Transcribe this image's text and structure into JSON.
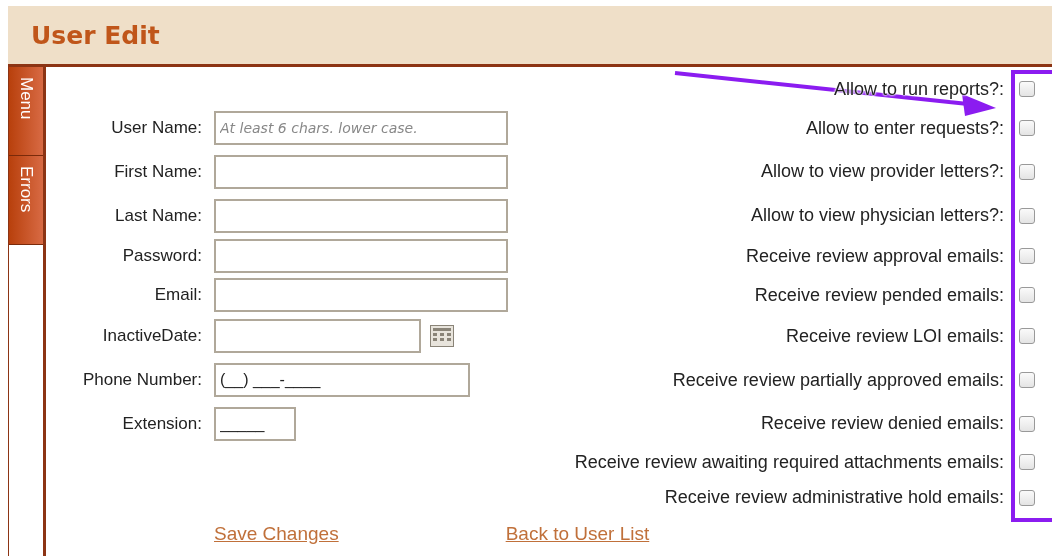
{
  "header": {
    "title": "User Edit"
  },
  "side_tabs": [
    {
      "label": "Menu"
    },
    {
      "label": "Errors"
    }
  ],
  "fields": [
    {
      "label": "User Name:",
      "kind": "text",
      "placeholder": "At least 6 chars. lower case."
    },
    {
      "label": "First Name:",
      "kind": "text"
    },
    {
      "label": "Last Name:",
      "kind": "text"
    },
    {
      "label": "Password:",
      "kind": "text"
    },
    {
      "label": "Email:",
      "kind": "text"
    },
    {
      "label": "InactiveDate:",
      "kind": "date"
    },
    {
      "label": "Phone Number:",
      "kind": "phone",
      "value": "(__) ___-____"
    },
    {
      "label": "Extension:",
      "kind": "extension",
      "value": "_____"
    }
  ],
  "permissions": [
    {
      "label": "Allow to run reports?:",
      "checked": false
    },
    {
      "label": "Allow to enter requests?:",
      "checked": false
    },
    {
      "label": "Allow to view provider letters?:",
      "checked": false
    },
    {
      "label": "Allow to view physician letters?:",
      "checked": false
    },
    {
      "label": "Receive review approval emails:",
      "checked": false
    },
    {
      "label": "Receive review pended emails:",
      "checked": false
    },
    {
      "label": "Receive review LOI emails:",
      "checked": false
    },
    {
      "label": "Receive review partially approved emails:",
      "checked": false
    },
    {
      "label": "Receive review denied emails:",
      "checked": false
    },
    {
      "label": "Receive review awaiting required attachments emails:",
      "checked": false
    },
    {
      "label": "Receive review administrative hold emails:",
      "checked": false
    }
  ],
  "links": [
    "Save Changes",
    "Back to User List"
  ]
}
